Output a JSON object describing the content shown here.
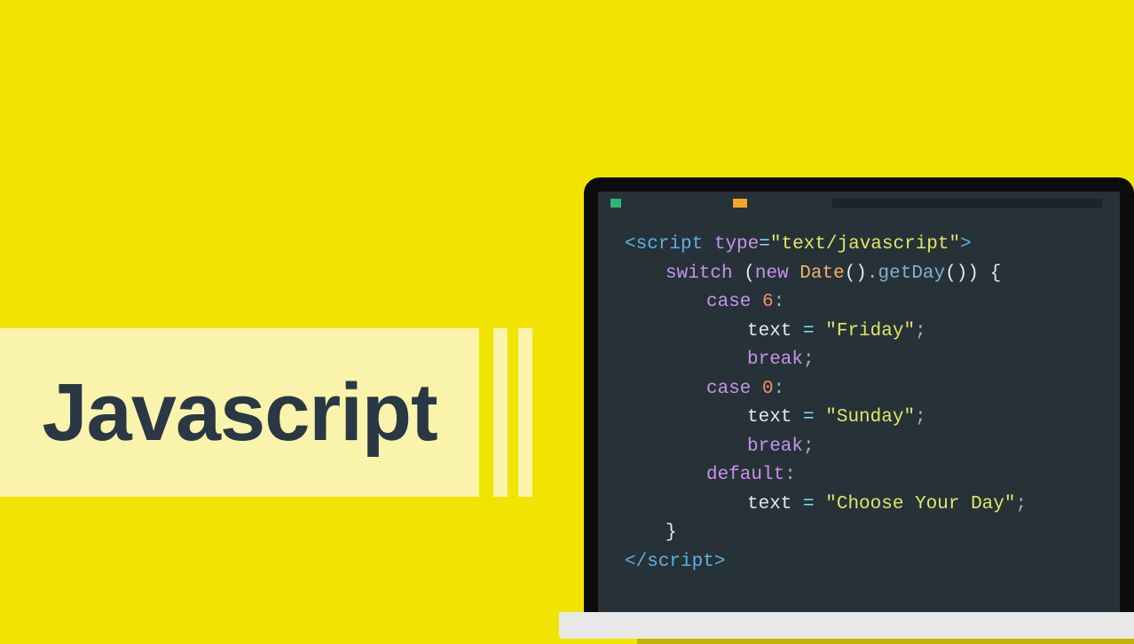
{
  "title": "Javascript",
  "code": {
    "line1": {
      "open": "<",
      "tag": "script",
      "sp": " ",
      "attr": "type",
      "eq": "=",
      "val": "\"text/javascript\"",
      "close": ">"
    },
    "line2": {
      "kw": "switch",
      "sp": " ",
      "p1": "(",
      "new": "new",
      "sp2": " ",
      "cls": "Date",
      "par": "()",
      "dot": ".",
      "method": "getDay",
      "par2": "()",
      "p2": ")",
      "sp3": " ",
      "brace": "{"
    },
    "line3": {
      "kw": "case",
      "sp": " ",
      "num": "6",
      "colon": ":"
    },
    "line4": {
      "ident": "text",
      "sp": " ",
      "eq": "=",
      "sp2": " ",
      "str": "\"Friday\"",
      "semi": ";"
    },
    "line5": {
      "kw": "break",
      "semi": ";"
    },
    "line6": {
      "kw": "case",
      "sp": " ",
      "num": "0",
      "colon": ":"
    },
    "line7": {
      "ident": "text",
      "sp": " ",
      "eq": "=",
      "sp2": " ",
      "str": "\"Sunday\"",
      "semi": ";"
    },
    "line8": {
      "kw": "break",
      "semi": ";"
    },
    "line9": {
      "kw": "default",
      "colon": ":"
    },
    "line10": {
      "ident": "text",
      "sp": " ",
      "eq": "=",
      "sp2": " ",
      "str": "\"Choose Your Day\"",
      "semi": ";"
    },
    "line11": {
      "brace": "}"
    },
    "line12": {
      "open": "</",
      "tag": "script",
      "close": ">"
    }
  }
}
